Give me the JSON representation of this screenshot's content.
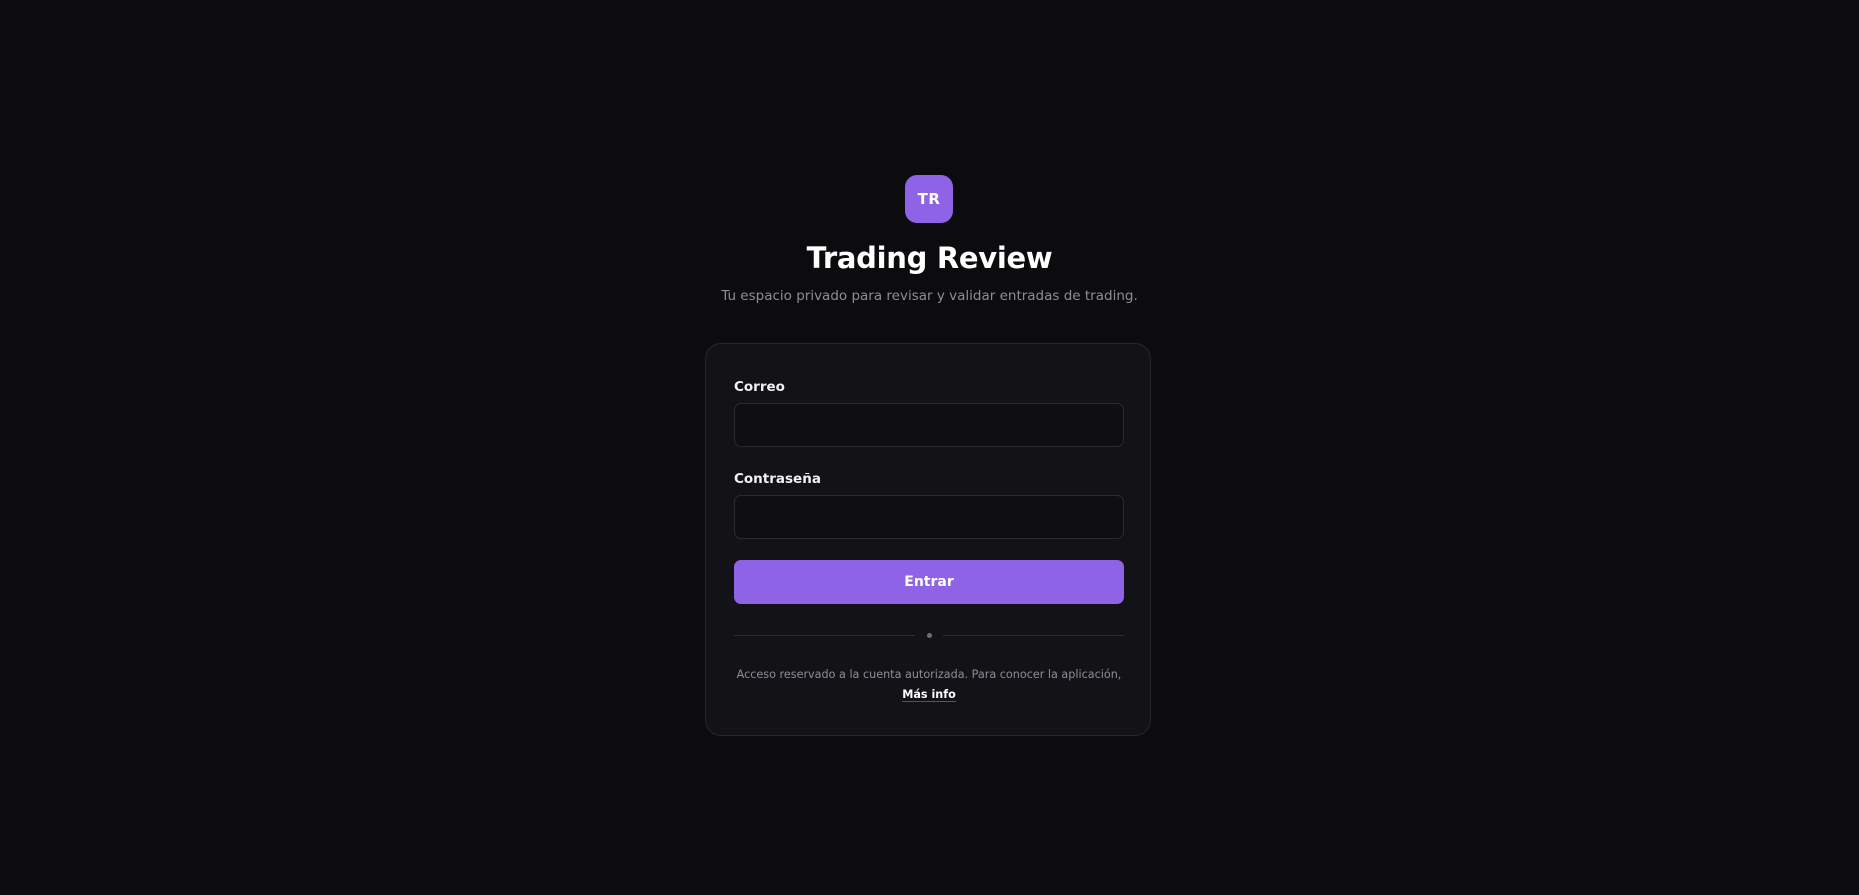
{
  "app": {
    "logo_text": "TR",
    "title": "Trading Review",
    "subtitle": "Tu espacio privado para revisar y validar entradas de trading."
  },
  "form": {
    "email_label": "Correo",
    "email_value": "",
    "password_label": "Contraseña",
    "password_value": "",
    "submit_label": "Entrar"
  },
  "footer": {
    "text": "Acceso reservado a la cuenta autorizada. Para conocer la aplicación,",
    "link_label": "Más info"
  },
  "colors": {
    "background": "#0c0c0f",
    "card": "#131317",
    "accent": "#8f63e6",
    "muted_text": "#8d8d96"
  }
}
